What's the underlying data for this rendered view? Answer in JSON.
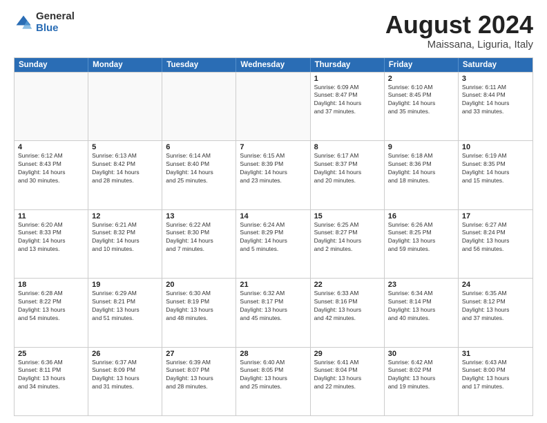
{
  "logo": {
    "general": "General",
    "blue": "Blue"
  },
  "title": {
    "month_year": "August 2024",
    "location": "Maissana, Liguria, Italy"
  },
  "header_days": [
    "Sunday",
    "Monday",
    "Tuesday",
    "Wednesday",
    "Thursday",
    "Friday",
    "Saturday"
  ],
  "weeks": [
    [
      {
        "day": "",
        "info": ""
      },
      {
        "day": "",
        "info": ""
      },
      {
        "day": "",
        "info": ""
      },
      {
        "day": "",
        "info": ""
      },
      {
        "day": "1",
        "info": "Sunrise: 6:09 AM\nSunset: 8:47 PM\nDaylight: 14 hours\nand 37 minutes."
      },
      {
        "day": "2",
        "info": "Sunrise: 6:10 AM\nSunset: 8:45 PM\nDaylight: 14 hours\nand 35 minutes."
      },
      {
        "day": "3",
        "info": "Sunrise: 6:11 AM\nSunset: 8:44 PM\nDaylight: 14 hours\nand 33 minutes."
      }
    ],
    [
      {
        "day": "4",
        "info": "Sunrise: 6:12 AM\nSunset: 8:43 PM\nDaylight: 14 hours\nand 30 minutes."
      },
      {
        "day": "5",
        "info": "Sunrise: 6:13 AM\nSunset: 8:42 PM\nDaylight: 14 hours\nand 28 minutes."
      },
      {
        "day": "6",
        "info": "Sunrise: 6:14 AM\nSunset: 8:40 PM\nDaylight: 14 hours\nand 25 minutes."
      },
      {
        "day": "7",
        "info": "Sunrise: 6:15 AM\nSunset: 8:39 PM\nDaylight: 14 hours\nand 23 minutes."
      },
      {
        "day": "8",
        "info": "Sunrise: 6:17 AM\nSunset: 8:37 PM\nDaylight: 14 hours\nand 20 minutes."
      },
      {
        "day": "9",
        "info": "Sunrise: 6:18 AM\nSunset: 8:36 PM\nDaylight: 14 hours\nand 18 minutes."
      },
      {
        "day": "10",
        "info": "Sunrise: 6:19 AM\nSunset: 8:35 PM\nDaylight: 14 hours\nand 15 minutes."
      }
    ],
    [
      {
        "day": "11",
        "info": "Sunrise: 6:20 AM\nSunset: 8:33 PM\nDaylight: 14 hours\nand 13 minutes."
      },
      {
        "day": "12",
        "info": "Sunrise: 6:21 AM\nSunset: 8:32 PM\nDaylight: 14 hours\nand 10 minutes."
      },
      {
        "day": "13",
        "info": "Sunrise: 6:22 AM\nSunset: 8:30 PM\nDaylight: 14 hours\nand 7 minutes."
      },
      {
        "day": "14",
        "info": "Sunrise: 6:24 AM\nSunset: 8:29 PM\nDaylight: 14 hours\nand 5 minutes."
      },
      {
        "day": "15",
        "info": "Sunrise: 6:25 AM\nSunset: 8:27 PM\nDaylight: 14 hours\nand 2 minutes."
      },
      {
        "day": "16",
        "info": "Sunrise: 6:26 AM\nSunset: 8:25 PM\nDaylight: 13 hours\nand 59 minutes."
      },
      {
        "day": "17",
        "info": "Sunrise: 6:27 AM\nSunset: 8:24 PM\nDaylight: 13 hours\nand 56 minutes."
      }
    ],
    [
      {
        "day": "18",
        "info": "Sunrise: 6:28 AM\nSunset: 8:22 PM\nDaylight: 13 hours\nand 54 minutes."
      },
      {
        "day": "19",
        "info": "Sunrise: 6:29 AM\nSunset: 8:21 PM\nDaylight: 13 hours\nand 51 minutes."
      },
      {
        "day": "20",
        "info": "Sunrise: 6:30 AM\nSunset: 8:19 PM\nDaylight: 13 hours\nand 48 minutes."
      },
      {
        "day": "21",
        "info": "Sunrise: 6:32 AM\nSunset: 8:17 PM\nDaylight: 13 hours\nand 45 minutes."
      },
      {
        "day": "22",
        "info": "Sunrise: 6:33 AM\nSunset: 8:16 PM\nDaylight: 13 hours\nand 42 minutes."
      },
      {
        "day": "23",
        "info": "Sunrise: 6:34 AM\nSunset: 8:14 PM\nDaylight: 13 hours\nand 40 minutes."
      },
      {
        "day": "24",
        "info": "Sunrise: 6:35 AM\nSunset: 8:12 PM\nDaylight: 13 hours\nand 37 minutes."
      }
    ],
    [
      {
        "day": "25",
        "info": "Sunrise: 6:36 AM\nSunset: 8:11 PM\nDaylight: 13 hours\nand 34 minutes."
      },
      {
        "day": "26",
        "info": "Sunrise: 6:37 AM\nSunset: 8:09 PM\nDaylight: 13 hours\nand 31 minutes."
      },
      {
        "day": "27",
        "info": "Sunrise: 6:39 AM\nSunset: 8:07 PM\nDaylight: 13 hours\nand 28 minutes."
      },
      {
        "day": "28",
        "info": "Sunrise: 6:40 AM\nSunset: 8:05 PM\nDaylight: 13 hours\nand 25 minutes."
      },
      {
        "day": "29",
        "info": "Sunrise: 6:41 AM\nSunset: 8:04 PM\nDaylight: 13 hours\nand 22 minutes."
      },
      {
        "day": "30",
        "info": "Sunrise: 6:42 AM\nSunset: 8:02 PM\nDaylight: 13 hours\nand 19 minutes."
      },
      {
        "day": "31",
        "info": "Sunrise: 6:43 AM\nSunset: 8:00 PM\nDaylight: 13 hours\nand 17 minutes."
      }
    ]
  ]
}
